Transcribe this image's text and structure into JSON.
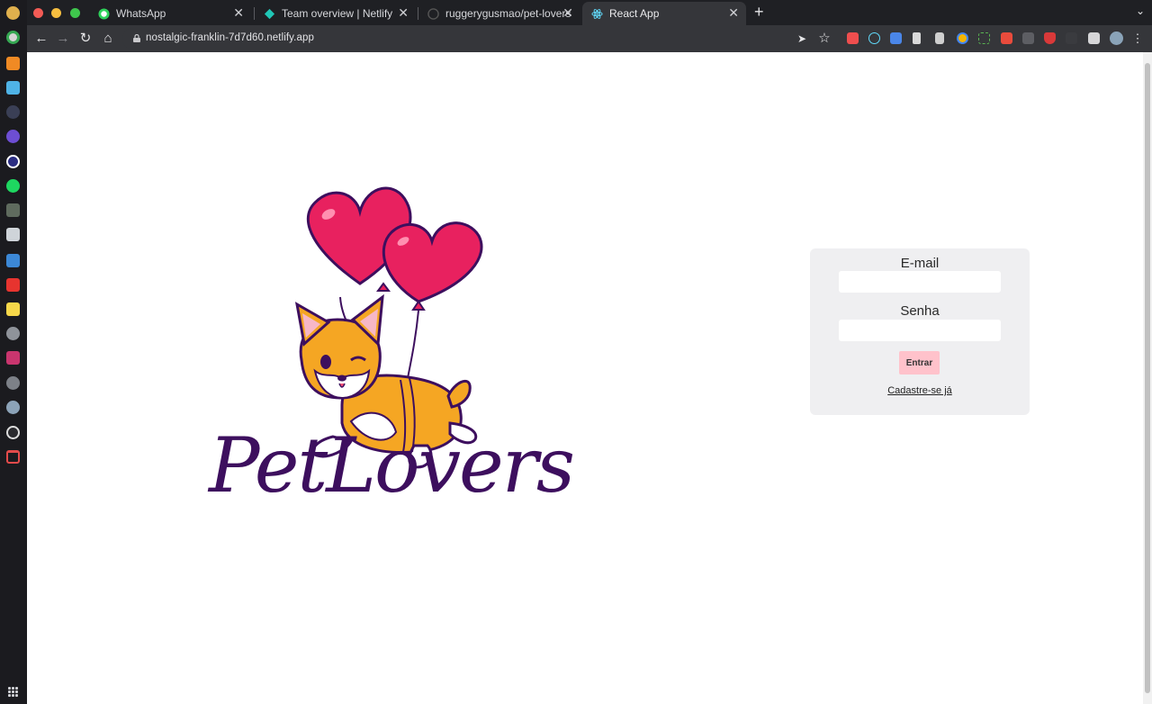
{
  "browser": {
    "tabs": [
      {
        "title": "WhatsApp",
        "favicon": "whatsapp-icon"
      },
      {
        "title": "Team overview | Netlify",
        "favicon": "netlify-icon"
      },
      {
        "title": "ruggerygusmao/pet-lovers",
        "favicon": "github-icon"
      },
      {
        "title": "React App",
        "favicon": "react-icon"
      }
    ],
    "url": "nostalgic-franklin-7d7d60.netlify.app"
  },
  "brand": {
    "name": "PetLovers",
    "colors": {
      "balloon": "#e8215f",
      "corgi": "#f5a623",
      "text": "#3d0f5e"
    }
  },
  "login": {
    "email_label": "E-mail",
    "email_value": "",
    "password_label": "Senha",
    "password_value": "",
    "submit_label": "Entrar",
    "signup_link": "Cadastre-se já",
    "colors": {
      "panel": "#efeff1",
      "button": "#ffc2cb"
    }
  }
}
